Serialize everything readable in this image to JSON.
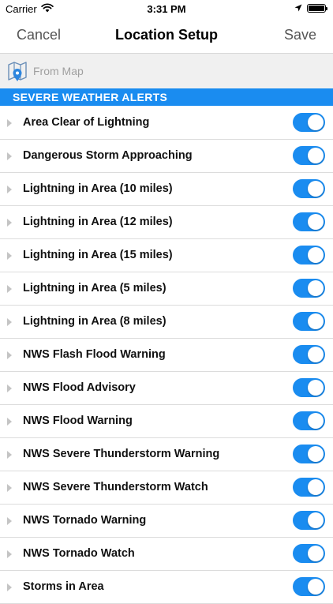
{
  "status_bar": {
    "carrier": "Carrier",
    "time": "3:31 PM",
    "icons": [
      "wifi-icon",
      "location-arrow-icon",
      "battery-icon"
    ]
  },
  "nav": {
    "cancel_label": "Cancel",
    "title": "Location Setup",
    "save_label": "Save"
  },
  "from_map": {
    "icon": "map-pin-icon",
    "label": "From Map"
  },
  "section": {
    "header": "SEVERE WEATHER ALERTS"
  },
  "alerts": [
    {
      "label": "Area Clear of Lightning",
      "enabled": true
    },
    {
      "label": "Dangerous Storm Approaching",
      "enabled": true
    },
    {
      "label": "Lightning in Area (10 miles)",
      "enabled": true
    },
    {
      "label": "Lightning in Area (12 miles)",
      "enabled": true
    },
    {
      "label": "Lightning in Area (15 miles)",
      "enabled": true
    },
    {
      "label": "Lightning in Area (5 miles)",
      "enabled": true
    },
    {
      "label": "Lightning in Area (8 miles)",
      "enabled": true
    },
    {
      "label": "NWS Flash Flood Warning",
      "enabled": true
    },
    {
      "label": "NWS Flood Advisory",
      "enabled": true
    },
    {
      "label": "NWS Flood Warning",
      "enabled": true
    },
    {
      "label": "NWS Severe Thunderstorm Warning",
      "enabled": true
    },
    {
      "label": "NWS Severe Thunderstorm Watch",
      "enabled": true
    },
    {
      "label": "NWS Tornado Warning",
      "enabled": true
    },
    {
      "label": "NWS Tornado Watch",
      "enabled": true
    },
    {
      "label": "Storms in Area",
      "enabled": true
    }
  ],
  "colors": {
    "accent": "#1a8cf0",
    "nav_text": "#555555",
    "placeholder": "#a0a0a0"
  }
}
